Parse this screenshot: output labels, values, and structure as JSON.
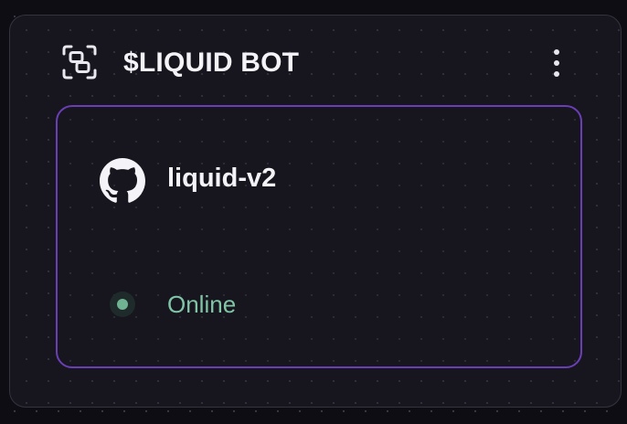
{
  "node": {
    "title": "$LIQUID BOT",
    "icon": "node-group-icon",
    "menu_icon": "more-vertical-icon"
  },
  "service": {
    "icon": "github-icon",
    "name": "liquid-v2",
    "status": "Online",
    "status_color": "#80c5a6"
  },
  "colors": {
    "card_border": "#6a3fb5",
    "panel_background": "#17161f",
    "page_background": "#0e0d14"
  }
}
